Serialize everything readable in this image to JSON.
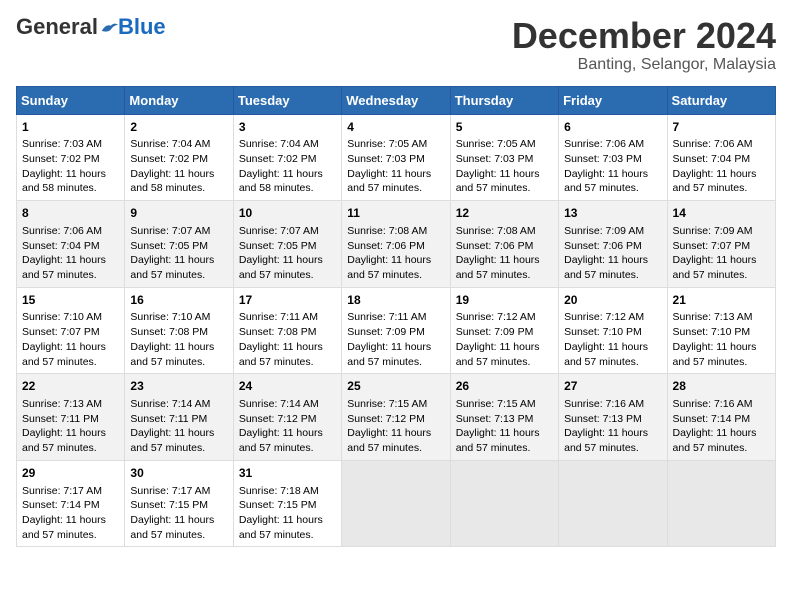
{
  "header": {
    "logo_general": "General",
    "logo_blue": "Blue",
    "month_title": "December 2024",
    "location": "Banting, Selangor, Malaysia"
  },
  "weekdays": [
    "Sunday",
    "Monday",
    "Tuesday",
    "Wednesday",
    "Thursday",
    "Friday",
    "Saturday"
  ],
  "weeks": [
    [
      {
        "day": "1",
        "sunrise": "7:03 AM",
        "sunset": "7:02 PM",
        "daylight": "11 hours and 58 minutes."
      },
      {
        "day": "2",
        "sunrise": "7:04 AM",
        "sunset": "7:02 PM",
        "daylight": "11 hours and 58 minutes."
      },
      {
        "day": "3",
        "sunrise": "7:04 AM",
        "sunset": "7:02 PM",
        "daylight": "11 hours and 58 minutes."
      },
      {
        "day": "4",
        "sunrise": "7:05 AM",
        "sunset": "7:03 PM",
        "daylight": "11 hours and 57 minutes."
      },
      {
        "day": "5",
        "sunrise": "7:05 AM",
        "sunset": "7:03 PM",
        "daylight": "11 hours and 57 minutes."
      },
      {
        "day": "6",
        "sunrise": "7:06 AM",
        "sunset": "7:03 PM",
        "daylight": "11 hours and 57 minutes."
      },
      {
        "day": "7",
        "sunrise": "7:06 AM",
        "sunset": "7:04 PM",
        "daylight": "11 hours and 57 minutes."
      }
    ],
    [
      {
        "day": "8",
        "sunrise": "7:06 AM",
        "sunset": "7:04 PM",
        "daylight": "11 hours and 57 minutes."
      },
      {
        "day": "9",
        "sunrise": "7:07 AM",
        "sunset": "7:05 PM",
        "daylight": "11 hours and 57 minutes."
      },
      {
        "day": "10",
        "sunrise": "7:07 AM",
        "sunset": "7:05 PM",
        "daylight": "11 hours and 57 minutes."
      },
      {
        "day": "11",
        "sunrise": "7:08 AM",
        "sunset": "7:06 PM",
        "daylight": "11 hours and 57 minutes."
      },
      {
        "day": "12",
        "sunrise": "7:08 AM",
        "sunset": "7:06 PM",
        "daylight": "11 hours and 57 minutes."
      },
      {
        "day": "13",
        "sunrise": "7:09 AM",
        "sunset": "7:06 PM",
        "daylight": "11 hours and 57 minutes."
      },
      {
        "day": "14",
        "sunrise": "7:09 AM",
        "sunset": "7:07 PM",
        "daylight": "11 hours and 57 minutes."
      }
    ],
    [
      {
        "day": "15",
        "sunrise": "7:10 AM",
        "sunset": "7:07 PM",
        "daylight": "11 hours and 57 minutes."
      },
      {
        "day": "16",
        "sunrise": "7:10 AM",
        "sunset": "7:08 PM",
        "daylight": "11 hours and 57 minutes."
      },
      {
        "day": "17",
        "sunrise": "7:11 AM",
        "sunset": "7:08 PM",
        "daylight": "11 hours and 57 minutes."
      },
      {
        "day": "18",
        "sunrise": "7:11 AM",
        "sunset": "7:09 PM",
        "daylight": "11 hours and 57 minutes."
      },
      {
        "day": "19",
        "sunrise": "7:12 AM",
        "sunset": "7:09 PM",
        "daylight": "11 hours and 57 minutes."
      },
      {
        "day": "20",
        "sunrise": "7:12 AM",
        "sunset": "7:10 PM",
        "daylight": "11 hours and 57 minutes."
      },
      {
        "day": "21",
        "sunrise": "7:13 AM",
        "sunset": "7:10 PM",
        "daylight": "11 hours and 57 minutes."
      }
    ],
    [
      {
        "day": "22",
        "sunrise": "7:13 AM",
        "sunset": "7:11 PM",
        "daylight": "11 hours and 57 minutes."
      },
      {
        "day": "23",
        "sunrise": "7:14 AM",
        "sunset": "7:11 PM",
        "daylight": "11 hours and 57 minutes."
      },
      {
        "day": "24",
        "sunrise": "7:14 AM",
        "sunset": "7:12 PM",
        "daylight": "11 hours and 57 minutes."
      },
      {
        "day": "25",
        "sunrise": "7:15 AM",
        "sunset": "7:12 PM",
        "daylight": "11 hours and 57 minutes."
      },
      {
        "day": "26",
        "sunrise": "7:15 AM",
        "sunset": "7:13 PM",
        "daylight": "11 hours and 57 minutes."
      },
      {
        "day": "27",
        "sunrise": "7:16 AM",
        "sunset": "7:13 PM",
        "daylight": "11 hours and 57 minutes."
      },
      {
        "day": "28",
        "sunrise": "7:16 AM",
        "sunset": "7:14 PM",
        "daylight": "11 hours and 57 minutes."
      }
    ],
    [
      {
        "day": "29",
        "sunrise": "7:17 AM",
        "sunset": "7:14 PM",
        "daylight": "11 hours and 57 minutes."
      },
      {
        "day": "30",
        "sunrise": "7:17 AM",
        "sunset": "7:15 PM",
        "daylight": "11 hours and 57 minutes."
      },
      {
        "day": "31",
        "sunrise": "7:18 AM",
        "sunset": "7:15 PM",
        "daylight": "11 hours and 57 minutes."
      },
      null,
      null,
      null,
      null
    ]
  ]
}
